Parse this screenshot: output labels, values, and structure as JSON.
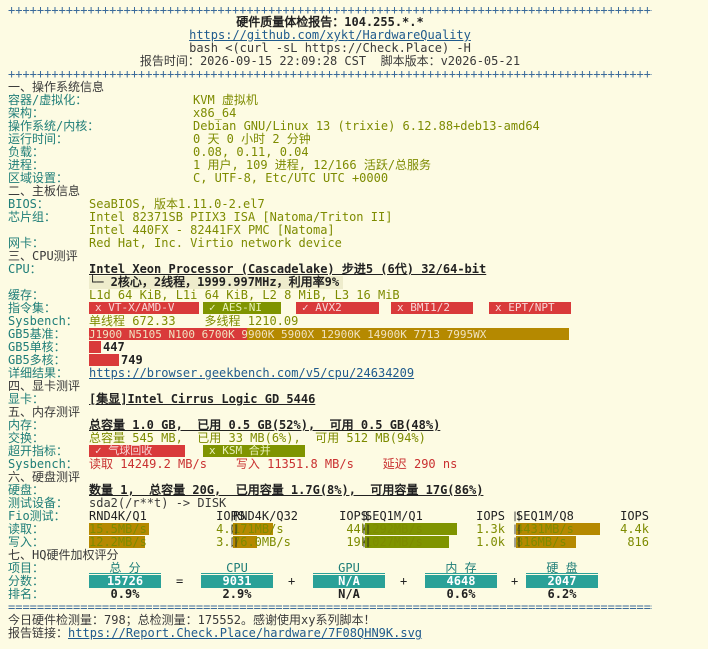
{
  "header": {
    "rule": "++++++++++++++++++++++++++++++++++++++++++++++++++++++++++++++++++++++++++++++++++++++++++++++++++",
    "title": "硬件质量体检报告：104.255.*.*",
    "repo": "https://github.com/xykt/HardwareQuality",
    "cmd": "bash <(curl -sL https://Check.Place) -H",
    "report_time_label": "报告时间：",
    "report_time": "2026-09-15 22:09:28 CST",
    "script_version_label": "脚本版本：",
    "script_version": "v2026-05-21"
  },
  "os": {
    "section": "一、操作系统信息",
    "rows": [
      {
        "label": "容器/虚拟化：",
        "value": "KVM 虚拟机"
      },
      {
        "label": "架构：",
        "value": "x86_64"
      },
      {
        "label": "操作系统/内核：",
        "value": "Debian GNU/Linux 13 (trixie) 6.12.88+deb13-amd64"
      },
      {
        "label": "运行时间：",
        "value": "0 天 0 小时 2 分钟"
      },
      {
        "label": "负载：",
        "value": "0.08, 0.11, 0.04"
      },
      {
        "label": "进程：",
        "value": "1 用户, 109 进程, 12/166 活跃/总服务"
      },
      {
        "label": "区域设置：",
        "value": "C, UTF-8, Etc/UTC UTC +0000"
      }
    ]
  },
  "board": {
    "section": "二、主板信息",
    "bios_label": "BIOS：",
    "bios": "SeaBIOS, 版本1.11.0-2.el7",
    "chip_label": "芯片组：",
    "chip1": "Intel 82371SB PIIX3 ISA [Natoma/Triton II]",
    "chip2": "Intel 440FX - 82441FX PMC [Natoma]",
    "nic_label": "网卡：",
    "nic": "Red Hat, Inc. Virtio network device"
  },
  "cpu": {
    "section": "三、CPU测评",
    "label": "CPU：",
    "model": "Intel Xeon Processor (Cascadelake) 步进5 (6代) 32/64-bit",
    "cores": "└─ 2核心，2线程，1999.997MHz，利用率9%",
    "cache_label": "缓存：",
    "cache": "L1d 64 KiB, L1i 64 KiB, L2 8 MiB, L3 16 MiB",
    "flags_label": "指令集：",
    "flags": [
      "x VT-X/AMD-V",
      "✓ AES-NI",
      "✓ AVX2",
      "x BMI1/2",
      "x EPT/NPT"
    ],
    "sysbench_label": "Sysbench：",
    "single_label": "单线程",
    "single": "672.33",
    "multi_label": "多线程",
    "multi": "1210.09",
    "gb5base_label": "GB5基准：",
    "gb5_scale": "J1900 N5105 N100 6700K 9900K 5900X 12900K 14900K 7713 7995WX",
    "gb5single_label": "GB5单核：",
    "gb5single": "447",
    "gb5multi_label": "GB5多核：",
    "gb5multi": "749",
    "detail_label": "详细结果：",
    "detail_url": "https://browser.geekbench.com/v5/cpu/24634209"
  },
  "gpu": {
    "section": "四、显卡测评",
    "label": "显卡：",
    "value": "[集显]Intel Cirrus Logic GD 5446"
  },
  "mem": {
    "section": "五、内存测评",
    "mem_label": "内存：",
    "mem": "总容量 1.0 GB,  已用 0.5 GB(52%),  可用 0.5 GB(48%)",
    "swap_label": "交换：",
    "swap": "总容量 545 MB,  已用 33 MB(6%),  可用 512 MB(94%)",
    "hyper_label": "超开指标：",
    "hyper": [
      "✓ 气球回收",
      "x KSM 合并"
    ],
    "sysbench_label": "Sysbench：",
    "read_label": "读取",
    "read": "14249.2 MB/s",
    "write_label": "写入",
    "write": "11351.8 MB/s",
    "latency_label": "延迟",
    "latency": "290 ns"
  },
  "disk": {
    "section": "六、硬盘测评",
    "disk_label": "硬盘：",
    "disk": "数量 1,  总容量 20G,  已用容量 1.7G(8%),  可用容量 17G(86%)",
    "device_label": "测试设备：",
    "device": "sda2(/r**t) -> DISK",
    "fio_label": "Fio测试：",
    "cols": [
      "RND4K/Q1",
      "IOPS",
      "RND4K/Q32",
      "IOPS",
      "SEQ1M/Q1",
      "IOPS",
      "SEQ1M/Q8",
      "IOPS"
    ],
    "read_label": "读取：",
    "read": [
      "15.5MB/s",
      "4.0k",
      "171MB/s",
      "44k",
      "1292MB/s",
      "1.3k",
      "4431MB/s",
      "4.4k"
    ],
    "write_label": "写入：",
    "write": [
      "12.2MB/s",
      "3.1k",
      "76.0MB/s",
      "19k",
      "1027MB/s",
      "1.0k",
      "816MB/s",
      "816"
    ]
  },
  "score": {
    "section": "七、HQ硬件加权评分",
    "item_label": "项目：",
    "score_label": "分数：",
    "rank_label": "排名：",
    "items": [
      {
        "name": "总 分",
        "score": "15726",
        "rank": "0.9%"
      },
      {
        "name": "CPU",
        "score": "9031",
        "rank": "2.9%"
      },
      {
        "name": "GPU",
        "score": "N/A",
        "rank": "N/A"
      },
      {
        "name": "内 存",
        "score": "4648",
        "rank": "0.6%"
      },
      {
        "name": "硬 盘",
        "score": "2047",
        "rank": "6.2%"
      }
    ],
    "ops": [
      "=",
      "+",
      "+",
      "+"
    ]
  },
  "footer": {
    "rule": "====================================================================================================",
    "stats": "今日硬件检测量：798；总检测量：175552。感谢使用xy系列脚本！",
    "link_label": "报告链接：",
    "link": "https://Report.Check.Place/hardware/7F08QHN9K.svg"
  },
  "colors": {
    "teal": "#2aa198",
    "olive": "#7f9400",
    "red": "#d93a3a",
    "bg": "#fdfbe3"
  }
}
